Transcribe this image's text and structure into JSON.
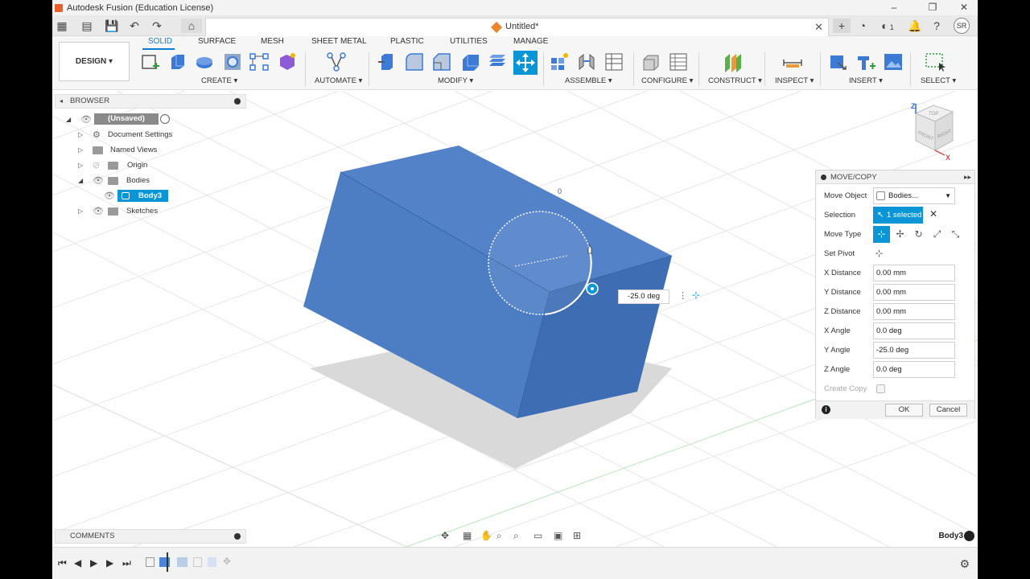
{
  "window": {
    "title": "Autodesk Fusion (Education License)",
    "minimize": "–",
    "maximize": "❐",
    "close": "✕"
  },
  "doc_tab": {
    "name": "Untitled*",
    "close": "✕"
  },
  "user": {
    "initials": "SR",
    "notifications": "1"
  },
  "workspace": {
    "label": "DESIGN ▾"
  },
  "tabs": [
    "SOLID",
    "SURFACE",
    "MESH",
    "SHEET METAL",
    "PLASTIC",
    "UTILITIES",
    "MANAGE"
  ],
  "groups": {
    "create": "CREATE ▾",
    "automate": "AUTOMATE ▾",
    "modify": "MODIFY ▾",
    "assemble": "ASSEMBLE ▾",
    "configure": "CONFIGURE ▾",
    "construct": "CONSTRUCT ▾",
    "inspect": "INSPECT ▾",
    "insert": "INSERT ▾",
    "select": "SELECT ▾"
  },
  "browser": {
    "title": "BROWSER",
    "root": "(Unsaved)",
    "items": [
      "Document Settings",
      "Named Views",
      "Origin",
      "Bodies",
      "Sketches"
    ],
    "body": "Body3"
  },
  "viewcube": {
    "top": "TOP",
    "front": "FRONT",
    "right": "RIGHT",
    "z": "Z",
    "x": "X"
  },
  "manipulator": {
    "angle_value": "-25.0 deg",
    "zero_mark": "0"
  },
  "move_copy": {
    "title": "MOVE/COPY",
    "move_object_label": "Move Object",
    "move_object_value": "Bodies...",
    "selection_label": "Selection",
    "selection_value": "1 selected",
    "move_type_label": "Move Type",
    "set_pivot_label": "Set Pivot",
    "x_distance_label": "X Distance",
    "x_distance": "0.00 mm",
    "y_distance_label": "Y Distance",
    "y_distance": "0.00 mm",
    "z_distance_label": "Z Distance",
    "z_distance": "0.00 mm",
    "x_angle_label": "X Angle",
    "x_angle": "0.0 deg",
    "y_angle_label": "Y Angle",
    "y_angle": "-25.0 deg",
    "z_angle_label": "Z Angle",
    "z_angle": "0.0 deg",
    "create_copy_label": "Create Copy",
    "ok": "OK",
    "cancel": "Cancel"
  },
  "comments": {
    "title": "COMMENTS"
  },
  "status": {
    "body_name": "Body3"
  },
  "colors": {
    "accent": "#0a96d6",
    "body": "#4d7ec4",
    "body_top": "#5382c8",
    "body_side": "#3e6db3"
  }
}
